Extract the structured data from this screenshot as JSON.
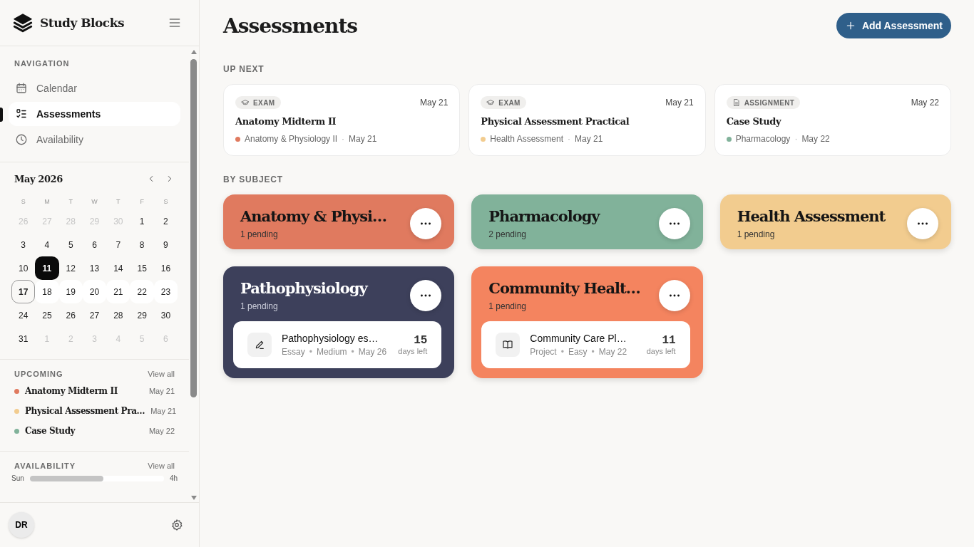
{
  "app": {
    "name": "Study Blocks"
  },
  "sidebar": {
    "nav_heading": "NAVIGATION",
    "nav": [
      {
        "label": "Calendar",
        "selected": false
      },
      {
        "label": "Assessments",
        "selected": true
      },
      {
        "label": "Availability",
        "selected": false
      }
    ],
    "calendar": {
      "month": "May 2026",
      "weekdays": [
        "S",
        "M",
        "T",
        "W",
        "T",
        "F",
        "S"
      ],
      "weeks": [
        [
          {
            "day": "26",
            "kind": "outside",
            "selected": false
          },
          {
            "day": "27",
            "kind": "outside",
            "selected": false
          },
          {
            "day": "28",
            "kind": "outside",
            "selected": false
          },
          {
            "day": "29",
            "kind": "outside",
            "selected": false
          },
          {
            "day": "30",
            "kind": "outside",
            "selected": false
          },
          {
            "day": "1",
            "kind": "normal",
            "selected": false
          },
          {
            "day": "2",
            "kind": "normal",
            "selected": false
          }
        ],
        [
          {
            "day": "3",
            "kind": "normal",
            "selected": false
          },
          {
            "day": "4",
            "kind": "normal",
            "selected": false
          },
          {
            "day": "5",
            "kind": "normal",
            "selected": false
          },
          {
            "day": "6",
            "kind": "normal",
            "selected": false
          },
          {
            "day": "7",
            "kind": "normal",
            "selected": false
          },
          {
            "day": "8",
            "kind": "normal",
            "selected": false
          },
          {
            "day": "9",
            "kind": "normal",
            "selected": false
          }
        ],
        [
          {
            "day": "10",
            "kind": "normal",
            "selected": false
          },
          {
            "day": "11",
            "kind": "normal",
            "selected": true
          },
          {
            "day": "12",
            "kind": "normal",
            "selected": false
          },
          {
            "day": "13",
            "kind": "normal",
            "selected": false
          },
          {
            "day": "14",
            "kind": "normal",
            "selected": false
          },
          {
            "day": "15",
            "kind": "normal",
            "selected": false
          },
          {
            "day": "16",
            "kind": "normal",
            "selected": false
          }
        ],
        [
          {
            "day": "17",
            "kind": "today",
            "selected": false
          },
          {
            "day": "18",
            "kind": "highlighted",
            "selected": false
          },
          {
            "day": "19",
            "kind": "highlighted",
            "selected": false
          },
          {
            "day": "20",
            "kind": "highlighted",
            "selected": false
          },
          {
            "day": "21",
            "kind": "highlighted",
            "selected": false
          },
          {
            "day": "22",
            "kind": "highlighted",
            "selected": false
          },
          {
            "day": "23",
            "kind": "highlighted",
            "selected": false
          }
        ],
        [
          {
            "day": "24",
            "kind": "normal",
            "selected": false
          },
          {
            "day": "25",
            "kind": "normal",
            "selected": false
          },
          {
            "day": "26",
            "kind": "normal",
            "selected": false
          },
          {
            "day": "27",
            "kind": "normal",
            "selected": false
          },
          {
            "day": "28",
            "kind": "normal",
            "selected": false
          },
          {
            "day": "29",
            "kind": "normal",
            "selected": false
          },
          {
            "day": "30",
            "kind": "normal",
            "selected": false
          }
        ],
        [
          {
            "day": "31",
            "kind": "normal",
            "selected": false
          },
          {
            "day": "1",
            "kind": "outside",
            "selected": false
          },
          {
            "day": "2",
            "kind": "outside",
            "selected": false
          },
          {
            "day": "3",
            "kind": "outside",
            "selected": false
          },
          {
            "day": "4",
            "kind": "outside",
            "selected": false
          },
          {
            "day": "5",
            "kind": "outside",
            "selected": false
          },
          {
            "day": "6",
            "kind": "outside",
            "selected": false
          }
        ]
      ]
    },
    "upcoming": {
      "heading": "UPCOMING",
      "view_all": "View all",
      "items": [
        {
          "title": "Anatomy Midterm II",
          "date": "May 21",
          "color": "#e07a5f"
        },
        {
          "title": "Physical Assessment Pra…",
          "date": "May 21",
          "color": "#f2cc8f"
        },
        {
          "title": "Case Study",
          "date": "May 22",
          "color": "#81b29a"
        }
      ]
    },
    "availability": {
      "heading": "AVAILABILITY",
      "view_all": "View all",
      "rows": [
        {
          "day": "Sun",
          "level": 0.55,
          "hours": "4h"
        }
      ]
    },
    "user": {
      "initials": "DR"
    }
  },
  "main": {
    "title": "Assessments",
    "add_button": "Add Assessment",
    "up_next_heading": "UP NEXT",
    "up_next": [
      {
        "kind": "exam",
        "badge": "EXAM",
        "date": "May 21",
        "title": "Anatomy Midterm II",
        "subject": "Anatomy & Physiology II",
        "separator": "·",
        "due": "May 21",
        "color": "#e07a5f"
      },
      {
        "kind": "exam",
        "badge": "EXAM",
        "date": "May 21",
        "title": "Physical Assessment Practical",
        "subject": "Health Assessment",
        "separator": "·",
        "due": "May 21",
        "color": "#f2cc8f"
      },
      {
        "kind": "assignment",
        "badge": "ASSIGNMENT",
        "date": "May 22",
        "title": "Case Study",
        "subject": "Pharmacology",
        "separator": "·",
        "due": "May 22",
        "color": "#81b29a"
      }
    ],
    "by_subject_heading": "BY SUBJECT",
    "subjects": [
      {
        "name": "Anatomy & Physi…",
        "pending": "1 pending",
        "color": "#e07a5f"
      },
      {
        "name": "Pharmacology",
        "pending": "2 pending",
        "color": "#81b29a"
      },
      {
        "name": "Health Assessment",
        "pending": "1 pending",
        "color": "#f2cc8f"
      },
      {
        "name": "Pathophysiology",
        "pending": "1 pending",
        "color": "#3d405b",
        "tasks": [
          {
            "kind": "essay",
            "title": "Pathophysiology es…",
            "meta": [
              "Essay",
              "•",
              "Medium",
              "•",
              "May 26"
            ],
            "days": "15",
            "days_label": "days left"
          }
        ]
      },
      {
        "name": "Community Healt…",
        "pending": "1 pending",
        "color": "#f4845f",
        "tasks": [
          {
            "kind": "project",
            "title": "Community Care Pl…",
            "meta": [
              "Project",
              "•",
              "Easy",
              "•",
              "May 22"
            ],
            "days": "11",
            "days_label": "days left"
          }
        ]
      }
    ]
  }
}
